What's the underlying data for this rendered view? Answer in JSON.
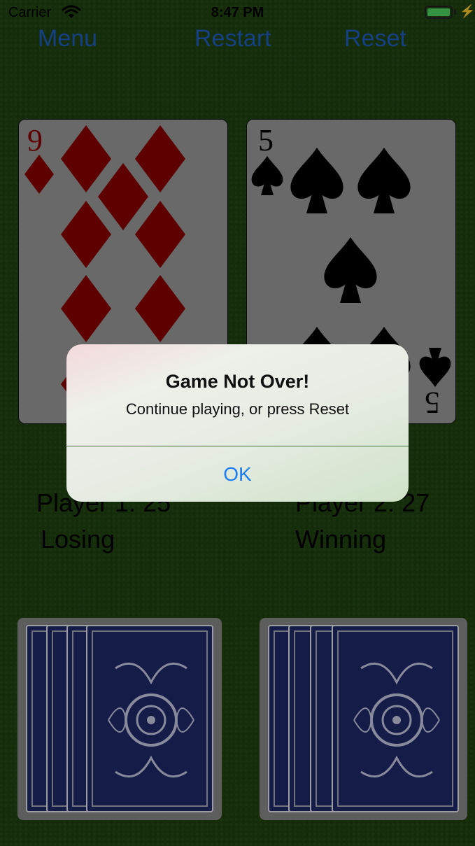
{
  "status_bar": {
    "carrier": "Carrier",
    "time": "8:47 PM"
  },
  "nav": {
    "menu": "Menu",
    "restart": "Restart",
    "reset": "Reset"
  },
  "cards": {
    "left": {
      "rank": "9",
      "suit": "diamonds",
      "color": "#8b0000"
    },
    "right": {
      "rank": "5",
      "suit": "spades",
      "color": "#000000"
    }
  },
  "players": {
    "p1": {
      "score_label": "Player 1:  25",
      "status": "Losing"
    },
    "p2": {
      "score_label": "Player 2: 27",
      "status": "Winning"
    }
  },
  "alert": {
    "title": "Game Not Over!",
    "message": "Continue playing, or press Reset",
    "ok": "OK"
  },
  "colors": {
    "felt": "#1f4310",
    "accent": "#1f5fc2",
    "alert_button": "#1a7cf2"
  }
}
